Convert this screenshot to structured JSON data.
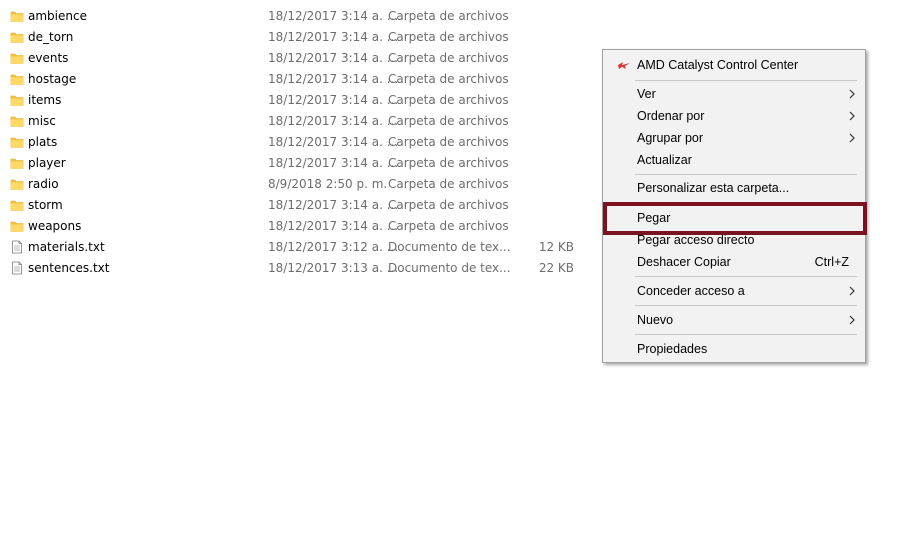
{
  "files": [
    {
      "name": "ambience",
      "date": "18/12/2017 3:14 a. ...",
      "type": "Carpeta de archivos",
      "size": "",
      "icon": "folder-icon"
    },
    {
      "name": "de_torn",
      "date": "18/12/2017 3:14 a. ...",
      "type": "Carpeta de archivos",
      "size": "",
      "icon": "folder-icon"
    },
    {
      "name": "events",
      "date": "18/12/2017 3:14 a. ...",
      "type": "Carpeta de archivos",
      "size": "",
      "icon": "folder-icon"
    },
    {
      "name": "hostage",
      "date": "18/12/2017 3:14 a. ...",
      "type": "Carpeta de archivos",
      "size": "",
      "icon": "folder-icon"
    },
    {
      "name": "items",
      "date": "18/12/2017 3:14 a. ...",
      "type": "Carpeta de archivos",
      "size": "",
      "icon": "folder-icon"
    },
    {
      "name": "misc",
      "date": "18/12/2017 3:14 a. ...",
      "type": "Carpeta de archivos",
      "size": "",
      "icon": "folder-icon"
    },
    {
      "name": "plats",
      "date": "18/12/2017 3:14 a. ...",
      "type": "Carpeta de archivos",
      "size": "",
      "icon": "folder-icon"
    },
    {
      "name": "player",
      "date": "18/12/2017 3:14 a. ...",
      "type": "Carpeta de archivos",
      "size": "",
      "icon": "folder-icon"
    },
    {
      "name": "radio",
      "date": "8/9/2018 2:50 p. m.",
      "type": "Carpeta de archivos",
      "size": "",
      "icon": "folder-icon"
    },
    {
      "name": "storm",
      "date": "18/12/2017 3:14 a. ...",
      "type": "Carpeta de archivos",
      "size": "",
      "icon": "folder-icon"
    },
    {
      "name": "weapons",
      "date": "18/12/2017 3:14 a. ...",
      "type": "Carpeta de archivos",
      "size": "",
      "icon": "folder-icon"
    },
    {
      "name": "materials.txt",
      "date": "18/12/2017 3:12 a. ...",
      "type": "Documento de tex...",
      "size": "12 KB",
      "icon": "text-file-icon"
    },
    {
      "name": "sentences.txt",
      "date": "18/12/2017 3:13 a. ...",
      "type": "Documento de tex...",
      "size": "22 KB",
      "icon": "text-file-icon"
    }
  ],
  "context_menu": {
    "amd": "AMD Catalyst Control Center",
    "ver": "Ver",
    "ordenar": "Ordenar por",
    "agrupar": "Agrupar por",
    "actualizar": "Actualizar",
    "personalizar": "Personalizar esta carpeta...",
    "pegar": "Pegar",
    "pegar_acceso": "Pegar acceso directo",
    "deshacer": "Deshacer Copiar",
    "deshacer_shortcut": "Ctrl+Z",
    "conceder": "Conceder acceso a",
    "nuevo": "Nuevo",
    "propiedades": "Propiedades"
  },
  "colors": {
    "folder": "#f5c542",
    "highlight": "#7a1222",
    "menu_bg": "#f2f2f2"
  }
}
